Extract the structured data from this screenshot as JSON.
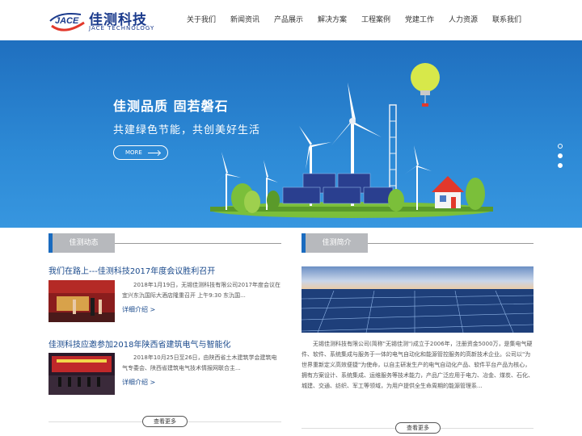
{
  "header": {
    "logo_mark": "JACE",
    "logo_cn": "佳测科技",
    "logo_en": "JACE TECHNOLOGY",
    "nav": [
      "关于我们",
      "新闻资讯",
      "产品展示",
      "解决方案",
      "工程案例",
      "党建工作",
      "人力资源",
      "联系我们"
    ]
  },
  "banner": {
    "title": "佳测品质 固若磐石",
    "subtitle": "共建绿色节能，共创美好生活",
    "more_label": "MORE",
    "slides": 3,
    "active_slide": 1
  },
  "news": {
    "section_title": "佳测动态",
    "items": [
      {
        "title": "我们在路上---佳测科技2017年度会议胜利召开",
        "summary": "2018年1月19日，无锡佳测科技有限公司2017年度会议在宜兴东氿国际大酒店隆重召开 上午9:30 东氿国...",
        "link": "详细介绍 >"
      },
      {
        "title": "佳测科技应邀参加2018年陕西省建筑电气与智能化",
        "summary": "2018年10月25日至26日，由陕西省土木建筑学会建筑电气专委会、陕西省建筑电气技术情报网联合主...",
        "link": "详细介绍 >"
      }
    ],
    "more_button": "查看更多"
  },
  "intro": {
    "section_title": "佳测简介",
    "text": "无锡佳测科技有限公司(简称\"无锡佳测\")成立于2006年，注册资金5000万，是集电气硬件、软件、系统集成与服务于一体的电气自动化和能源管控服务的高新技术企业。公司以\"为世界重新定义高效便捷\"为使命，以自主研发生产的电气自动化产品、软件平台产品为核心，拥有方案设计、系统集成、运维服务等技术能力，产品广泛应用于电力、冶金、煤炭、石化、城建、交通、纺织、军工等领域，为用户提供全生命周期的能源管理系...",
    "more_button": "查看更多"
  },
  "colors": {
    "brand_blue": "#1a4a8c",
    "accent_blue": "#1a6bbf",
    "banner_blue": "#2d8ad6",
    "logo_red": "#e2382b"
  }
}
